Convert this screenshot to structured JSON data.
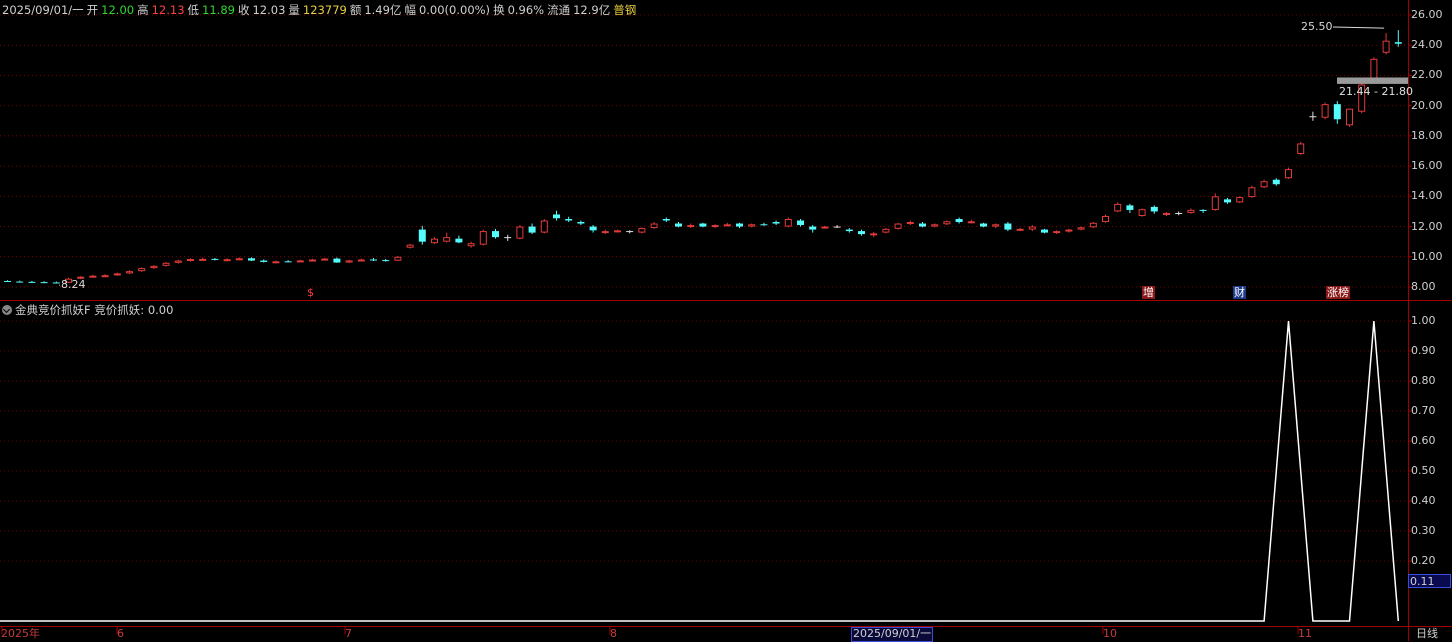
{
  "info_bar": {
    "date": "2025/09/01/一",
    "open_label": "开",
    "open": "12.00",
    "high_label": "高",
    "high": "12.13",
    "low_label": "低",
    "low": "11.89",
    "close_label": "收",
    "close": "12.03",
    "volume_label": "量",
    "volume": "123779",
    "amount_label": "额",
    "amount": "1.49亿",
    "change_label": "幅",
    "change": "0.00(0.00%)",
    "turnover_label": "换",
    "turnover": "0.96%",
    "float_label": "流通",
    "float_cap": "12.9亿",
    "category": "普钢"
  },
  "indicator": {
    "title": "金典竞价抓妖F",
    "line_name": "竞价抓妖",
    "line_value": "0.00",
    "current_value_box": "0.11"
  },
  "annotations": {
    "high_price": "25.50",
    "low_price": "8.24",
    "price_range": "21.44 - 21.80"
  },
  "event_tags": [
    "$",
    "增",
    "财",
    "涨榜"
  ],
  "x_axis_labels": [
    "2025年",
    "6",
    "7",
    "8",
    "10",
    "11"
  ],
  "cursor_date": "2025/09/01/一",
  "period": "日线",
  "colors": {
    "up": "#e03a3a",
    "down": "#54fcfc",
    "doji": "#e0e0e0",
    "grid": "#7a0000",
    "indicator_line": "#ffffff"
  },
  "chart_data": [
    {
      "type": "candlestick",
      "y_axis_ticks": [
        "26.00",
        "24.00",
        "22.00",
        "20.00",
        "18.00",
        "16.00",
        "14.00",
        "12.00",
        "10.00",
        "8.00"
      ],
      "ylim": [
        7.5,
        26.2
      ],
      "ohlc": [
        [
          8.4,
          8.45,
          8.33,
          8.36
        ],
        [
          8.36,
          8.42,
          8.3,
          8.34
        ],
        [
          8.34,
          8.4,
          8.28,
          8.32
        ],
        [
          8.32,
          8.38,
          8.26,
          8.3
        ],
        [
          8.3,
          8.36,
          8.24,
          8.28
        ],
        [
          8.28,
          8.6,
          8.27,
          8.55
        ],
        [
          8.55,
          8.72,
          8.52,
          8.68
        ],
        [
          8.68,
          8.8,
          8.62,
          8.75
        ],
        [
          8.75,
          8.85,
          8.68,
          8.78
        ],
        [
          8.78,
          8.95,
          8.74,
          8.9
        ],
        [
          8.9,
          9.1,
          8.86,
          9.05
        ],
        [
          9.05,
          9.3,
          9.0,
          9.25
        ],
        [
          9.25,
          9.45,
          9.2,
          9.4
        ],
        [
          9.4,
          9.65,
          9.35,
          9.6
        ],
        [
          9.6,
          9.8,
          9.55,
          9.75
        ],
        [
          9.75,
          9.9,
          9.68,
          9.85
        ],
        [
          9.85,
          9.95,
          9.78,
          9.86
        ],
        [
          9.86,
          9.92,
          9.76,
          9.82
        ],
        [
          9.82,
          9.9,
          9.74,
          9.84
        ],
        [
          9.84,
          9.95,
          9.78,
          9.9
        ],
        [
          9.9,
          9.96,
          9.72,
          9.75
        ],
        [
          9.75,
          9.82,
          9.62,
          9.66
        ],
        [
          9.66,
          9.75,
          9.58,
          9.7
        ],
        [
          9.7,
          9.78,
          9.62,
          9.68
        ],
        [
          9.68,
          9.8,
          9.64,
          9.76
        ],
        [
          9.76,
          9.86,
          9.7,
          9.82
        ],
        [
          9.82,
          9.92,
          9.76,
          9.88
        ],
        [
          9.88,
          9.95,
          9.6,
          9.62
        ],
        [
          9.62,
          9.8,
          9.58,
          9.76
        ],
        [
          9.76,
          9.88,
          9.7,
          9.82
        ],
        [
          9.82,
          9.92,
          9.72,
          9.78
        ],
        [
          9.78,
          9.86,
          9.68,
          9.74
        ],
        [
          9.74,
          10.05,
          9.72,
          10.0
        ],
        [
          10.6,
          10.85,
          10.55,
          10.8
        ],
        [
          11.8,
          12.05,
          10.8,
          11.0
        ],
        [
          10.9,
          11.3,
          10.85,
          11.2
        ],
        [
          11.0,
          11.6,
          10.95,
          11.3
        ],
        [
          11.2,
          11.4,
          10.9,
          10.95
        ],
        [
          10.7,
          11.0,
          10.6,
          10.9
        ],
        [
          10.8,
          11.8,
          10.75,
          11.7
        ],
        [
          11.7,
          11.85,
          11.2,
          11.3
        ],
        [
          11.3,
          11.45,
          11.05,
          11.3
        ],
        [
          11.2,
          12.1,
          11.15,
          12.0
        ],
        [
          12.0,
          12.2,
          11.5,
          11.6
        ],
        [
          11.6,
          12.5,
          11.55,
          12.4
        ],
        [
          12.8,
          13.05,
          12.4,
          12.55
        ],
        [
          12.5,
          12.65,
          12.3,
          12.4
        ],
        [
          12.3,
          12.4,
          12.1,
          12.2
        ],
        [
          12.0,
          12.1,
          11.6,
          11.75
        ],
        [
          11.6,
          11.8,
          11.5,
          11.7
        ],
        [
          11.7,
          11.8,
          11.6,
          11.75
        ],
        [
          11.7,
          11.75,
          11.55,
          11.7
        ],
        [
          11.6,
          11.95,
          11.55,
          11.9
        ],
        [
          11.9,
          12.3,
          11.85,
          12.2
        ],
        [
          12.5,
          12.6,
          12.3,
          12.4
        ],
        [
          12.2,
          12.3,
          11.95,
          12.0
        ],
        [
          12.0,
          12.2,
          11.9,
          12.1
        ],
        [
          12.2,
          12.25,
          11.95,
          12.0
        ],
        [
          12.0,
          12.15,
          11.9,
          12.1
        ],
        [
          12.1,
          12.25,
          12.0,
          12.15
        ],
        [
          12.2,
          12.25,
          11.9,
          12.0
        ],
        [
          12.0,
          12.2,
          11.95,
          12.15
        ],
        [
          12.15,
          12.25,
          12.05,
          12.1
        ],
        [
          12.3,
          12.4,
          12.1,
          12.2
        ],
        [
          12.0,
          12.6,
          11.95,
          12.5
        ],
        [
          12.4,
          12.5,
          12.0,
          12.1
        ],
        [
          12.0,
          12.1,
          11.6,
          11.8
        ],
        [
          11.9,
          12.05,
          11.85,
          12.0
        ],
        [
          12.0,
          12.1,
          11.9,
          12.0
        ],
        [
          11.8,
          11.9,
          11.6,
          11.7
        ],
        [
          11.7,
          11.8,
          11.4,
          11.5
        ],
        [
          11.5,
          11.65,
          11.3,
          11.55
        ],
        [
          11.6,
          11.9,
          11.55,
          11.85
        ],
        [
          11.85,
          12.25,
          11.8,
          12.2
        ],
        [
          12.2,
          12.4,
          12.1,
          12.3
        ],
        [
          12.2,
          12.3,
          11.95,
          12.0
        ],
        [
          12.0,
          12.2,
          11.95,
          12.15
        ],
        [
          12.15,
          12.4,
          12.1,
          12.35
        ],
        [
          12.5,
          12.6,
          12.2,
          12.3
        ],
        [
          12.3,
          12.45,
          12.2,
          12.35
        ],
        [
          12.2,
          12.25,
          11.95,
          12.0
        ],
        [
          12.0,
          12.2,
          11.9,
          12.15
        ],
        [
          12.2,
          12.3,
          11.7,
          11.8
        ],
        [
          11.8,
          11.9,
          11.7,
          11.85
        ],
        [
          11.8,
          12.1,
          11.7,
          12.0
        ],
        [
          11.8,
          11.85,
          11.55,
          11.6
        ],
        [
          11.6,
          11.75,
          11.5,
          11.7
        ],
        [
          11.7,
          11.85,
          11.6,
          11.8
        ],
        [
          11.8,
          12.0,
          11.75,
          11.95
        ],
        [
          11.95,
          12.3,
          11.9,
          12.25
        ],
        [
          12.3,
          12.8,
          12.25,
          12.7
        ],
        [
          13.0,
          13.6,
          12.95,
          13.5
        ],
        [
          13.4,
          13.5,
          12.9,
          13.1
        ],
        [
          12.7,
          13.2,
          12.65,
          13.15
        ],
        [
          13.3,
          13.4,
          12.85,
          13.0
        ],
        [
          12.8,
          12.95,
          12.7,
          12.9
        ],
        [
          12.9,
          13.0,
          12.75,
          12.9
        ],
        [
          12.9,
          13.2,
          12.85,
          13.1
        ],
        [
          13.1,
          13.15,
          12.9,
          13.05
        ],
        [
          13.1,
          14.2,
          13.05,
          14.0
        ],
        [
          13.8,
          13.9,
          13.5,
          13.6
        ],
        [
          13.6,
          14.0,
          13.55,
          13.95
        ],
        [
          13.95,
          14.7,
          13.9,
          14.6
        ],
        [
          14.6,
          15.1,
          14.55,
          15.0
        ],
        [
          15.1,
          15.2,
          14.7,
          14.8
        ],
        [
          15.2,
          15.9,
          15.15,
          15.8
        ],
        [
          16.8,
          17.6,
          16.75,
          17.5
        ],
        [
          19.3,
          19.6,
          19.0,
          19.3
        ],
        [
          19.2,
          20.2,
          19.1,
          20.1
        ],
        [
          20.1,
          20.3,
          18.8,
          19.1
        ],
        [
          18.7,
          19.8,
          18.6,
          19.8
        ],
        [
          19.6,
          21.5,
          19.5,
          21.4
        ],
        [
          21.6,
          23.2,
          21.5,
          23.1
        ],
        [
          23.5,
          24.8,
          23.4,
          24.3
        ],
        [
          24.2,
          25.0,
          23.9,
          24.1
        ]
      ]
    },
    {
      "type": "line",
      "name": "竞价抓妖",
      "y_axis_ticks": [
        "1.00",
        "0.90",
        "0.80",
        "0.70",
        "0.60",
        "0.50",
        "0.40",
        "0.30",
        "0.20"
      ],
      "ylim": [
        0,
        1.0
      ],
      "x": [
        0,
        103,
        105,
        107,
        110,
        112,
        114
      ],
      "values": [
        0,
        0,
        1,
        0,
        0,
        1,
        0
      ]
    }
  ]
}
